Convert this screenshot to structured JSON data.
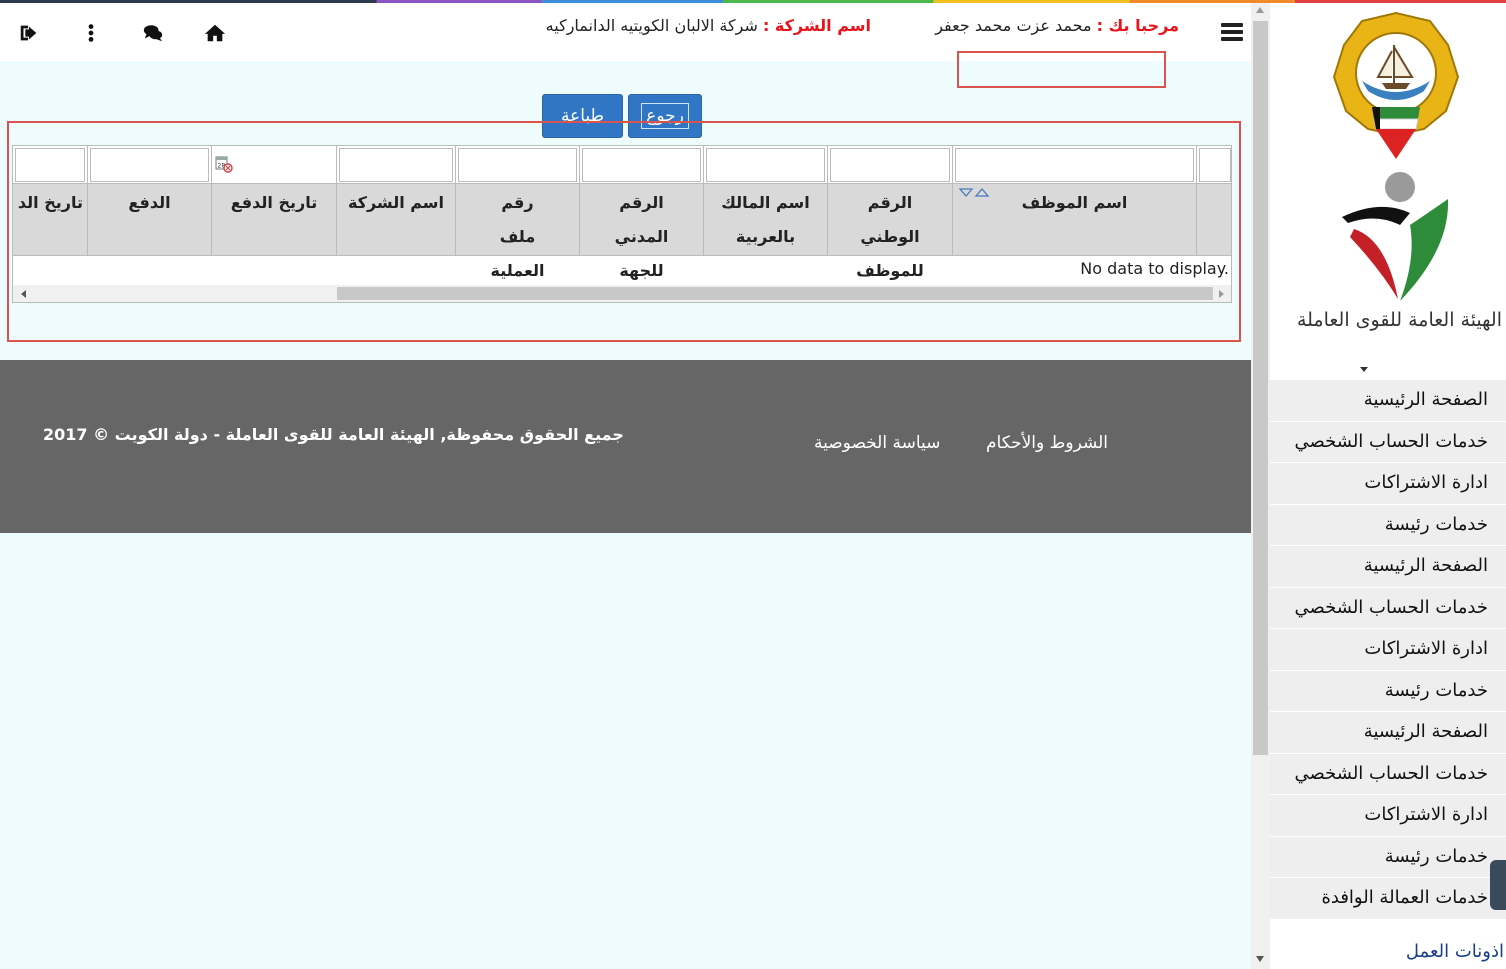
{
  "header": {
    "welcome_label": "مرحبا بك :",
    "user_name": "محمد عزت محمد جعفر",
    "company_label": "اسم الشركة :",
    "company_name": "شركة الالبان الكويتيه الدانماركيه",
    "icons": [
      "logout-icon",
      "more-vertical-icon",
      "chat-icon",
      "home-icon",
      "menu-icon"
    ]
  },
  "buttons": {
    "print_label": "طباعة",
    "back_label": "رجوع"
  },
  "grid": {
    "columns": [
      "اسم الموظف",
      "الرقم الوطني للموظف",
      "اسم المالك بالعربية",
      "الرقم المدني للجهة",
      "رقم ملف العملية",
      "اسم الشركة",
      "تاريخ الدفع",
      "الدفع",
      "تاريخ الد"
    ],
    "empty_message": "No data to display."
  },
  "footer": {
    "copyright": "جميع الحقوق محفوظة, الهيئة العامة للقوى العاملة - دولة الكويت © 2017",
    "terms_link": "الشروط والأحكام",
    "privacy_link": "سياسة الخصوصية"
  },
  "sidebar": {
    "org_name": "الهيئة العامة للقوى العاملة",
    "menu": [
      "الصفحة الرئيسية",
      "خدمات الحساب الشخصي",
      "ادارة الاشتراكات",
      "خدمات رئيسة",
      "الصفحة الرئيسية",
      "خدمات الحساب الشخصي",
      "ادارة الاشتراكات",
      "خدمات رئيسة",
      "الصفحة الرئيسية",
      "خدمات الحساب الشخصي",
      "ادارة الاشتراكات",
      "خدمات رئيسة",
      "خدمات العمالة الوافدة"
    ],
    "sub_link": "اذونات العمل"
  }
}
